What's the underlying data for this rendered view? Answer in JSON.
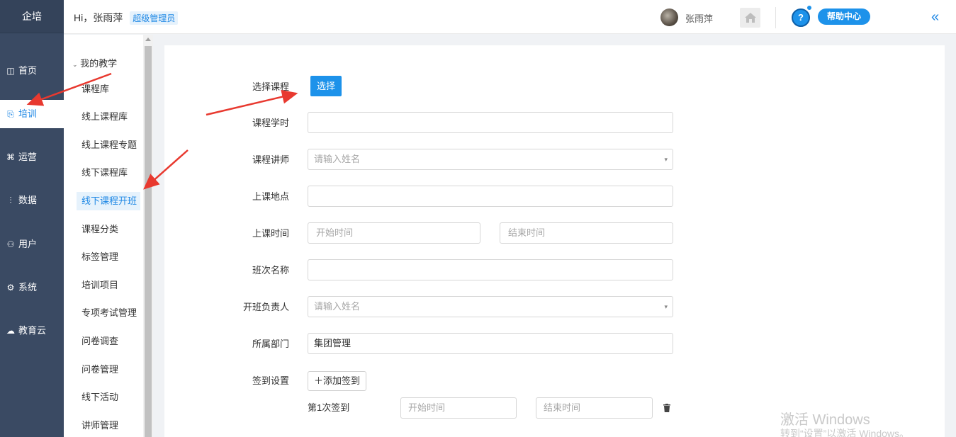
{
  "sidebar": {
    "brand": "企培",
    "items": [
      {
        "label": "首页",
        "icon": "dashboard-icon",
        "glyph": "◫"
      },
      {
        "label": "培训",
        "icon": "training-icon",
        "glyph": "⎘",
        "active": true
      },
      {
        "label": "运营",
        "icon": "operations-icon",
        "glyph": "⌘"
      },
      {
        "label": "数据",
        "icon": "data-chart-icon",
        "glyph": "⫶"
      },
      {
        "label": "用户",
        "icon": "user-icon",
        "glyph": "⚇"
      },
      {
        "label": "系统",
        "icon": "settings-icon",
        "glyph": "⚙"
      },
      {
        "label": "教育云",
        "icon": "cloud-icon",
        "glyph": "☁"
      }
    ]
  },
  "header": {
    "greeting": "Hi，张雨萍",
    "role": "超级管理员",
    "user_name": "张雨萍",
    "help_label": "帮助中心",
    "collapse_glyph": "«",
    "help_glyph": "?"
  },
  "submenu": {
    "group": "我的教学",
    "items": [
      "课程库",
      "线上课程库",
      "线上课程专题",
      "线下课程库",
      "线下课程开班",
      "课程分类",
      "标签管理",
      "培训项目",
      "专项考试管理",
      "问卷调查",
      "问卷管理",
      "线下活动",
      "讲师管理"
    ],
    "active_index": 4
  },
  "form": {
    "select_course_label": "选择课程",
    "select_button": "选择",
    "hours_label": "课程学时",
    "hours_value": "",
    "lecturer_label": "课程讲师",
    "lecturer_placeholder": "请输入姓名",
    "location_label": "上课地点",
    "location_value": "",
    "time_label": "上课时间",
    "start_placeholder": "开始时间",
    "end_placeholder": "结束时间",
    "class_name_label": "班次名称",
    "class_name_value": "",
    "owner_label": "开班负责人",
    "owner_placeholder": "请输入姓名",
    "dept_label": "所属部门",
    "dept_value": "集团管理",
    "signin_label": "签到设置",
    "add_signin_button": "＋添加签到",
    "signin_row_label": "第1次签到",
    "signin_start_placeholder": "开始时间",
    "signin_end_placeholder": "结束时间",
    "dropdown_caret": "▾"
  },
  "watermark": {
    "line1": "激活 Windows",
    "line2": "转到“设置”以激活 Windows。"
  },
  "colors": {
    "rail": "#3a4a63",
    "accent": "#1d92ea",
    "annotation_arrow": "#e8392f"
  }
}
